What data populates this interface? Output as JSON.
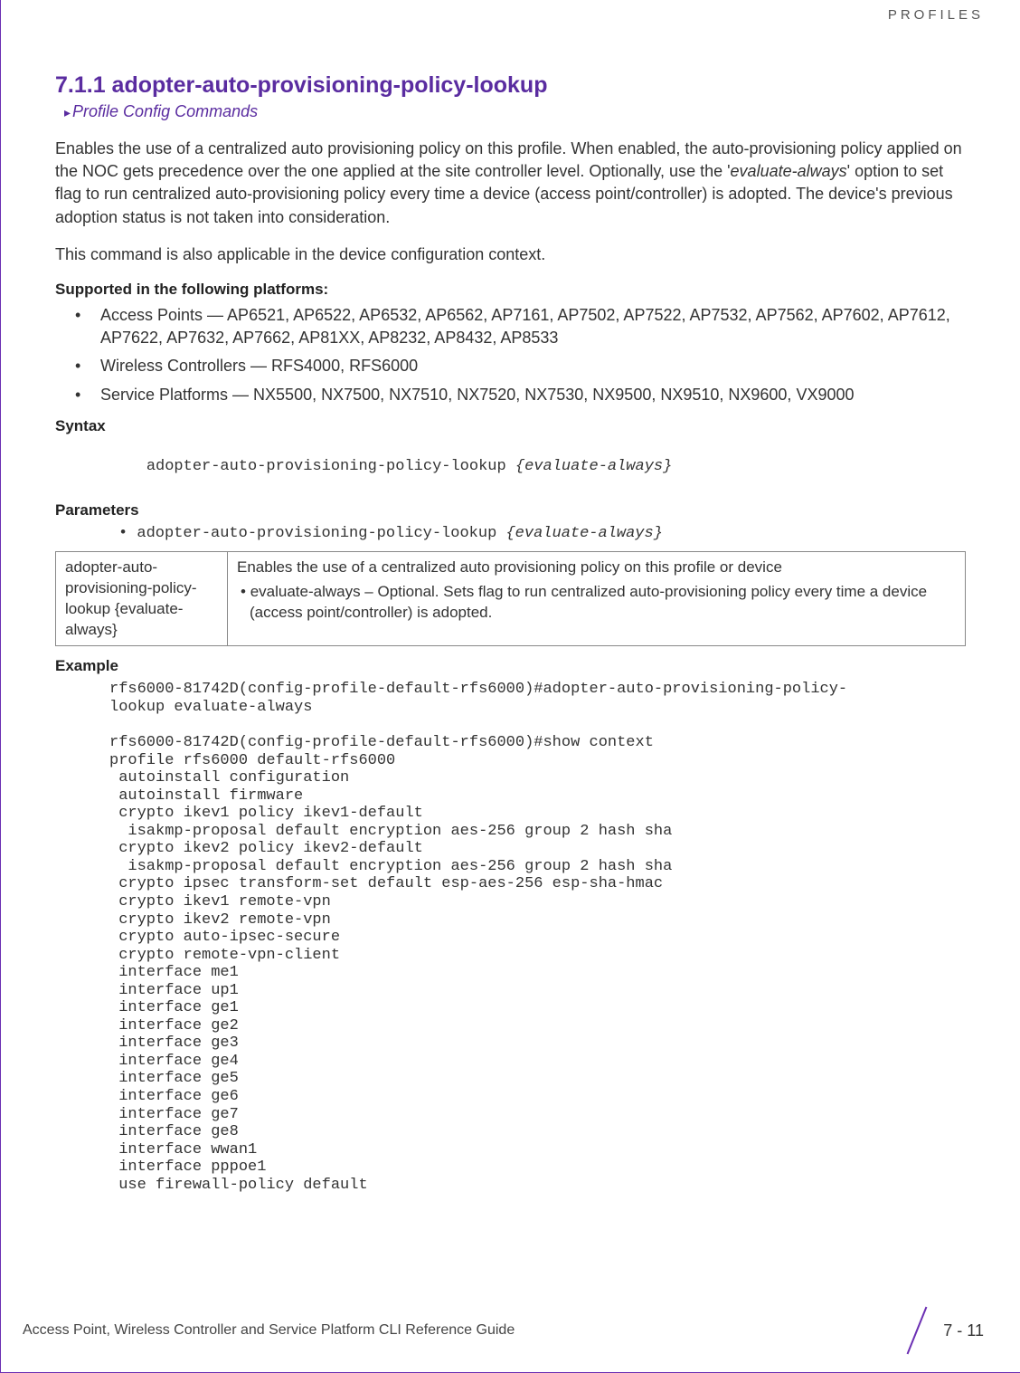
{
  "header": {
    "chapter_label": "PROFILES"
  },
  "section": {
    "number_title": "7.1.1 adopter-auto-provisioning-policy-lookup",
    "breadcrumb": "Profile Config Commands",
    "para1_pre": "Enables the use of a centralized auto provisioning policy on this profile. When enabled, the auto-provisioning policy applied on the NOC gets precedence over the one applied at the site controller level. Optionally, use the '",
    "para1_em": "evaluate-always",
    "para1_post": "' option to set flag to run centralized auto-provisioning policy every time a device (access point/controller) is adopted. The device's previous adoption status is not taken into consideration.",
    "para2": "This command is also applicable in the device configuration context."
  },
  "platforms": {
    "heading": "Supported in the following platforms:",
    "items": [
      "Access Points — AP6521, AP6522, AP6532, AP6562, AP7161, AP7502, AP7522, AP7532, AP7562, AP7602, AP7612, AP7622, AP7632, AP7662, AP81XX, AP8232, AP8432, AP8533",
      "Wireless Controllers — RFS4000, RFS6000",
      "Service Platforms — NX5500, NX7500, NX7510, NX7520, NX7530, NX9500, NX9510, NX9600, VX9000"
    ]
  },
  "syntax": {
    "heading": "Syntax",
    "line_cmd": "adopter-auto-provisioning-policy-lookup ",
    "line_arg": "{evaluate-always}"
  },
  "parameters": {
    "heading": "Parameters",
    "line_cmd": "adopter-auto-provisioning-policy-lookup ",
    "line_arg": "{evaluate-always}",
    "table": {
      "left": "adopter-auto-provisioning-policy-lookup {evaluate-always}",
      "right_top": "Enables the use of a centralized auto provisioning policy on this profile or device",
      "right_bullet": "evaluate-always – Optional. Sets flag to run centralized auto-provisioning policy every time a device (access point/controller) is adopted."
    }
  },
  "example": {
    "heading": "Example",
    "block": "rfs6000-81742D(config-profile-default-rfs6000)#adopter-auto-provisioning-policy-\nlookup evaluate-always\n\nrfs6000-81742D(config-profile-default-rfs6000)#show context\nprofile rfs6000 default-rfs6000\n autoinstall configuration\n autoinstall firmware\n crypto ikev1 policy ikev1-default\n  isakmp-proposal default encryption aes-256 group 2 hash sha\n crypto ikev2 policy ikev2-default\n  isakmp-proposal default encryption aes-256 group 2 hash sha\n crypto ipsec transform-set default esp-aes-256 esp-sha-hmac\n crypto ikev1 remote-vpn\n crypto ikev2 remote-vpn\n crypto auto-ipsec-secure\n crypto remote-vpn-client\n interface me1\n interface up1\n interface ge1\n interface ge2\n interface ge3\n interface ge4\n interface ge5\n interface ge6\n interface ge7\n interface ge8\n interface wwan1\n interface pppoe1\n use firewall-policy default"
  },
  "footer": {
    "doc_title": "Access Point, Wireless Controller and Service Platform CLI Reference Guide",
    "page": "7 - 11"
  }
}
